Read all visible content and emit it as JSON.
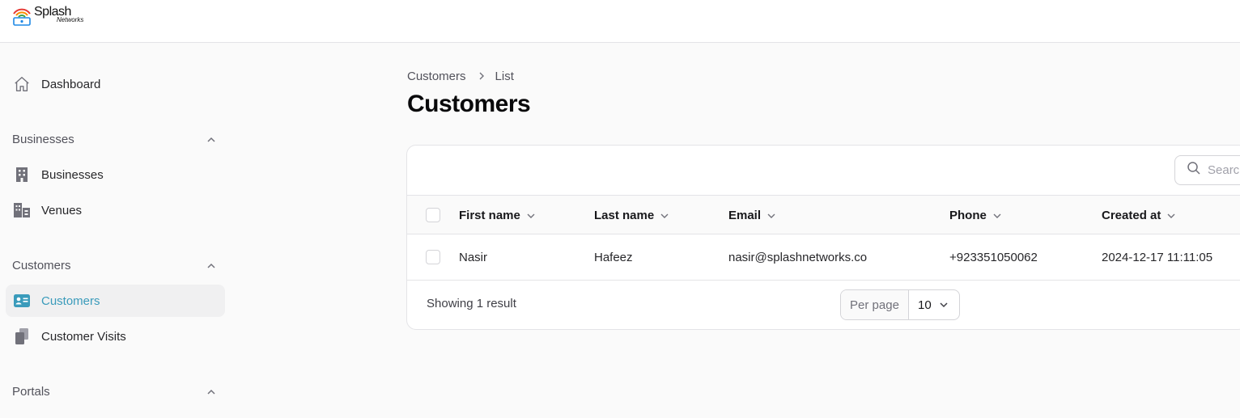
{
  "brand": {
    "logo_word": "Splash",
    "logo_sub": "Networks",
    "accent": "#3a9bbb"
  },
  "sidebar": {
    "dashboard": {
      "label": "Dashboard",
      "icon": "home-icon"
    },
    "groups": [
      {
        "title": "Businesses",
        "items": [
          {
            "label": "Businesses",
            "icon": "building-icon"
          },
          {
            "label": "Venues",
            "icon": "buildings-icon"
          }
        ]
      },
      {
        "title": "Customers",
        "items": [
          {
            "label": "Customers",
            "icon": "id-card-icon",
            "active": true
          },
          {
            "label": "Customer Visits",
            "icon": "documents-icon"
          }
        ]
      },
      {
        "title": "Portals",
        "items": []
      }
    ]
  },
  "breadcrumb": {
    "parent": "Customers",
    "current": "List"
  },
  "page": {
    "title": "Customers"
  },
  "table": {
    "search_placeholder": "Search",
    "columns": [
      "First name",
      "Last name",
      "Email",
      "Phone",
      "Created at"
    ],
    "rows": [
      {
        "first_name": "Nasir",
        "last_name": "Hafeez",
        "email": "nasir@splashnetworks.co",
        "phone": "+923351050062",
        "created_at": "2024-12-17 11:11:05"
      }
    ],
    "footer": {
      "showing": "Showing 1 result",
      "per_page_label": "Per page",
      "per_page_value": "10"
    }
  }
}
